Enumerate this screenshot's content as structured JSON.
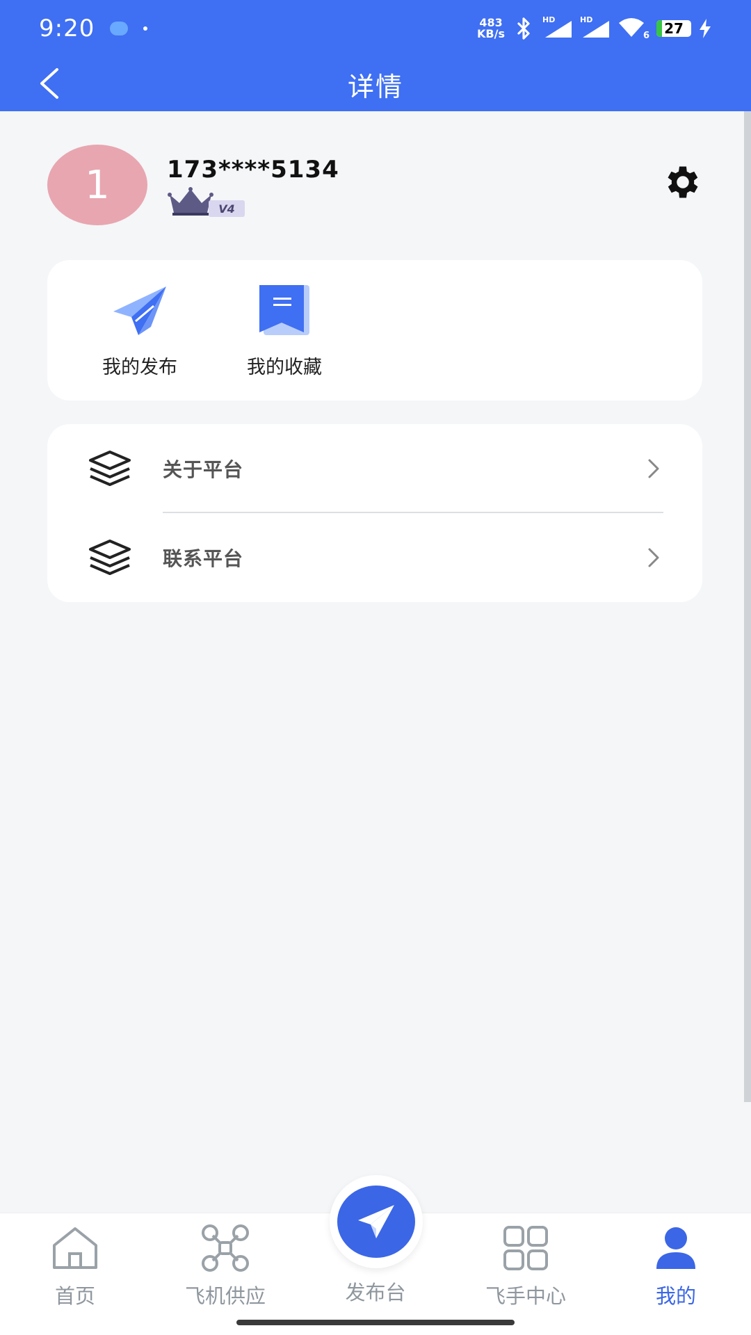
{
  "status_bar": {
    "time": "9:20",
    "net_speed_value": "483",
    "net_speed_unit": "KB/s",
    "battery_level": "27",
    "network_sub": "6",
    "hd_label": "HD"
  },
  "header": {
    "title": "详情"
  },
  "profile": {
    "avatar_text": "1",
    "phone": "173****5134",
    "vip_level": "V4"
  },
  "quick_actions": [
    {
      "label": "我的发布",
      "icon": "paper-plane-icon"
    },
    {
      "label": "我的收藏",
      "icon": "bookmark-icon"
    }
  ],
  "menu": [
    {
      "label": "关于平台",
      "icon": "layers-icon"
    },
    {
      "label": "联系平台",
      "icon": "layers-icon"
    }
  ],
  "tabbar": {
    "tabs": [
      {
        "label": "首页",
        "icon": "home-icon"
      },
      {
        "label": "飞机供应",
        "icon": "drone-icon"
      },
      {
        "label": "发布台",
        "icon": "paper-plane-icon"
      },
      {
        "label": "飞手中心",
        "icon": "grid-icon"
      },
      {
        "label": "我的",
        "icon": "user-icon"
      }
    ],
    "active_index": 4
  },
  "colors": {
    "primary": "#3f6ff2",
    "active_tab": "#3b66e6",
    "inactive_tab": "#8f979e",
    "avatar_bg": "#e8a6b0",
    "page_bg": "#f4f6f8"
  }
}
